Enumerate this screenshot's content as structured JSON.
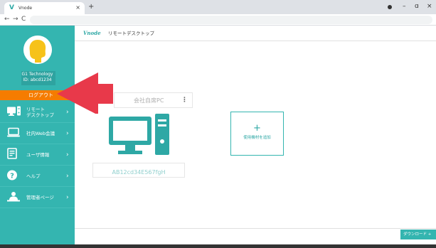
{
  "browser": {
    "tab_title": "Vnode",
    "tab_favicon": "V",
    "tab_close": "×",
    "new_tab": "+",
    "nav_back": "←",
    "nav_forward": "→",
    "nav_reload": "C",
    "win_minimize": "–",
    "win_maximize": "ɑ",
    "win_close": "×"
  },
  "sidebar": {
    "company_name": "G1 Technology",
    "user_id": "ID: abcd1234",
    "logout_label": "ログアウト",
    "items": [
      {
        "label_line1": "リモート",
        "label_line2": "デスクトップ",
        "icon": "monitor-icon"
      },
      {
        "label": "社内Web会議",
        "icon": "laptop-icon"
      },
      {
        "label": "ユーザ情報",
        "icon": "document-icon"
      },
      {
        "label": "ヘルプ",
        "icon": "help-icon"
      },
      {
        "label": "管理者ページ",
        "icon": "admin-icon"
      }
    ],
    "chevron": "›"
  },
  "header": {
    "logo": "Vnode",
    "title": "リモートデスクトップ"
  },
  "main": {
    "pc_name": "会社自席PC",
    "kebab": "⋮",
    "pc_id": "AB12cd34E567fgH",
    "add_plus": "+",
    "add_label": "使用機材を追加"
  },
  "footer": {
    "download_label": "ダウンロード +"
  },
  "colors": {
    "sidebar": "#34b5b0",
    "logout": "#f57c00",
    "arrow": "#e8394a",
    "accent": "#2ea8a5"
  }
}
